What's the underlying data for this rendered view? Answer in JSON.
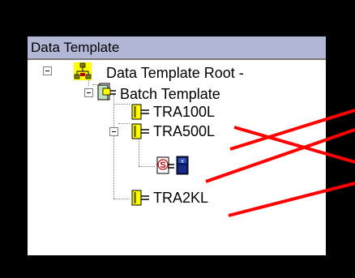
{
  "panel": {
    "title": "Data Template"
  },
  "tree": {
    "root": {
      "label": "Data Template Root -",
      "icon": "network-icon"
    },
    "batch": {
      "label": "Batch Template",
      "icon": "batch-template-icon"
    },
    "children": [
      {
        "label": "TRA100L",
        "icon": "tank-icon"
      },
      {
        "label": "TRA500L",
        "icon": "tank-icon"
      },
      {
        "label": "TRA2KL",
        "icon": "tank-icon"
      }
    ],
    "sub_node": {
      "icons": [
        "script-icon",
        "blue-chip-icon"
      ]
    }
  },
  "colors": {
    "title_bar": "#b3b7d6",
    "annotation_lines": "#ff0000",
    "background": "#000000"
  }
}
